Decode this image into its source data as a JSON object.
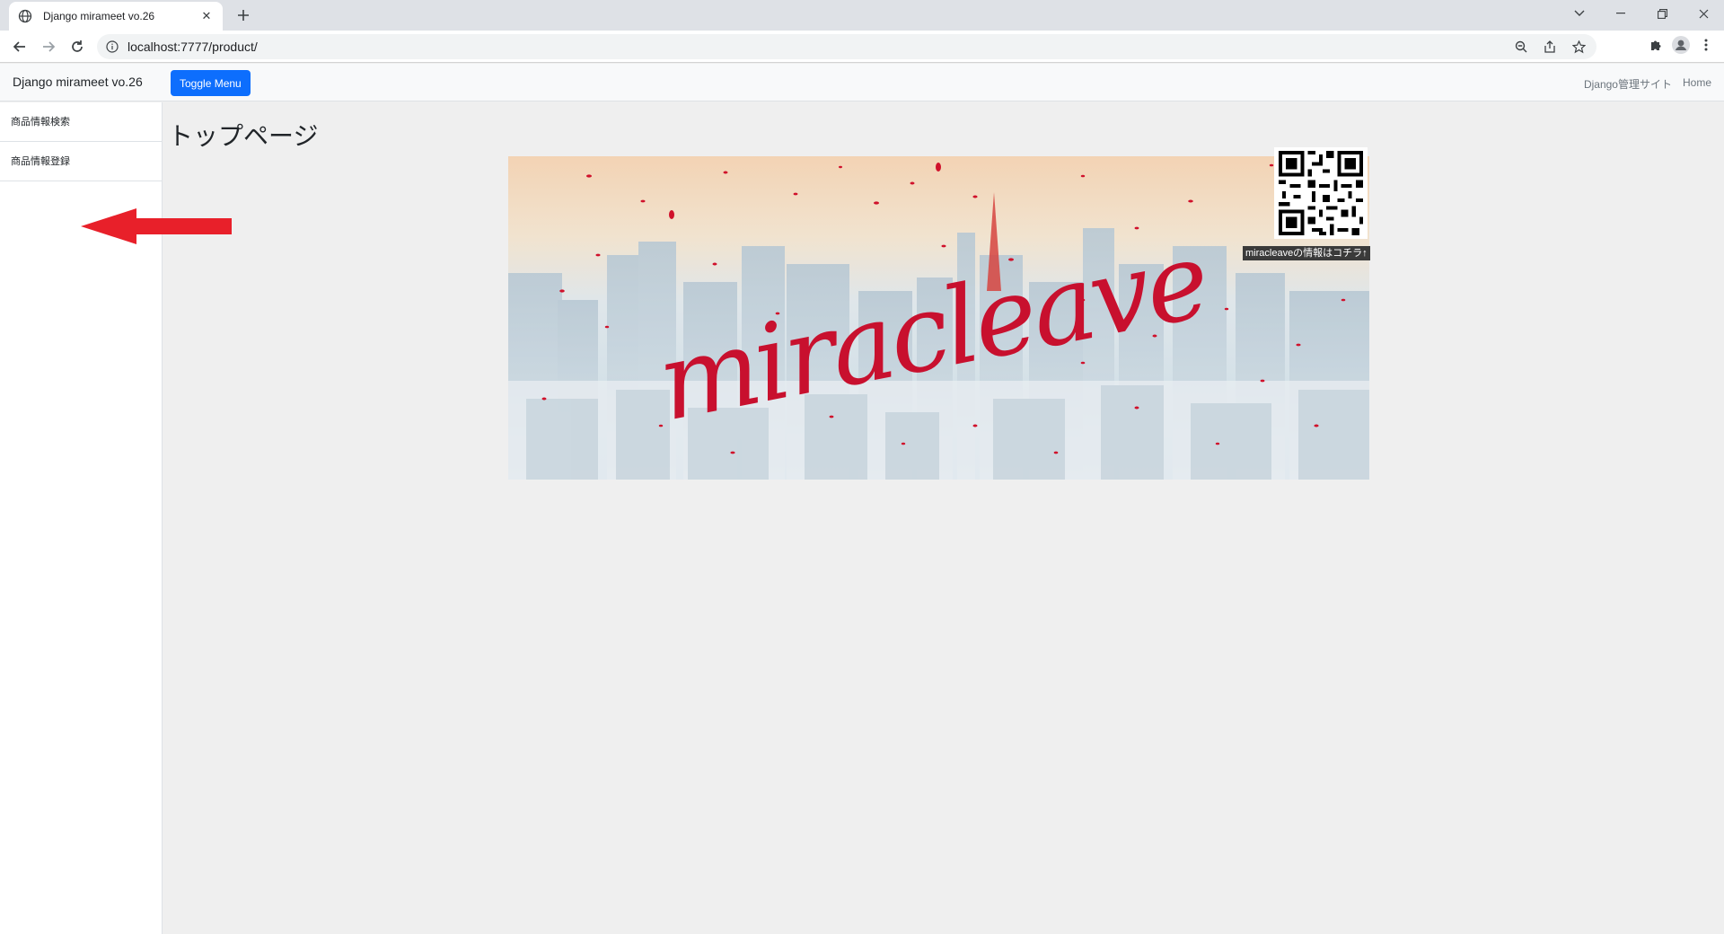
{
  "browser": {
    "tab_title": "Django mirameet vo.26",
    "url": "localhost:7777/product/"
  },
  "navbar": {
    "brand": "Django mirameet vo.26",
    "toggle_label": "Toggle Menu",
    "links": [
      "Django管理サイト",
      "Home"
    ]
  },
  "sidebar": {
    "items": [
      {
        "label": "商品情報検索"
      },
      {
        "label": "商品情報登録"
      }
    ]
  },
  "main": {
    "title": "トップページ",
    "banner_logo": "miracleave",
    "qr_caption": "miracleaveの情報はコチラ↑"
  },
  "colors": {
    "primary": "#0d6efd",
    "arrow": "#e8202a",
    "logo_red": "#c8102e"
  }
}
